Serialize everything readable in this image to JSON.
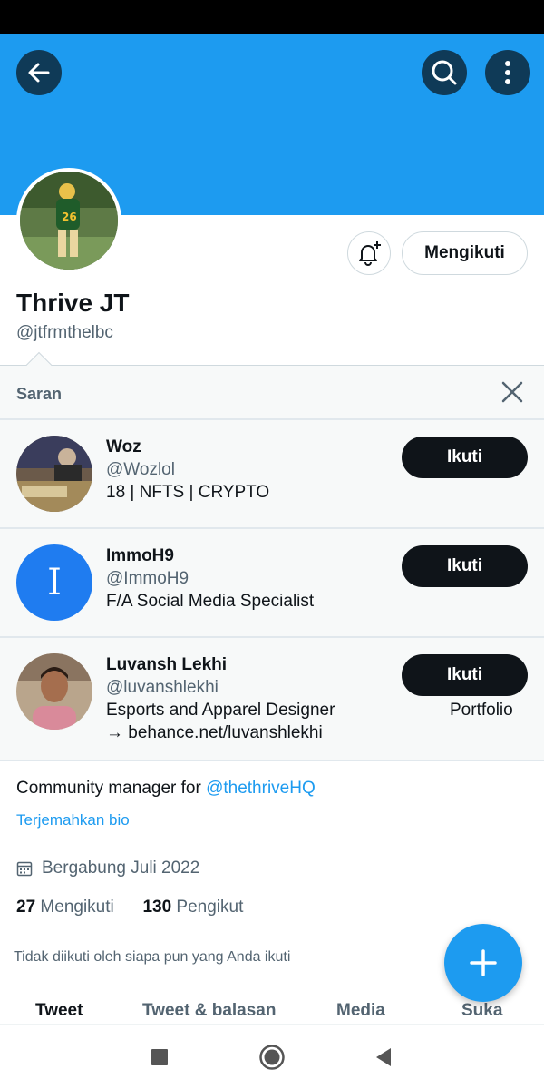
{
  "profile": {
    "name": "Thrive JT",
    "handle": "@jtfrmthelbc",
    "follow_status_label": "Mengikuti",
    "bio_text": "Community manager for ",
    "bio_link": "@thethriveHQ",
    "translate_label": "Terjemahkan bio",
    "joined": "Bergabung Juli 2022",
    "following_count": "27",
    "following_label": "Mengikuti",
    "followers_count": "130",
    "followers_label": "Pengikut",
    "followed_by_note": "Tidak diikuti oleh siapa pun yang Anda ikuti"
  },
  "suggestions": {
    "title": "Saran",
    "follow_label": "Ikuti",
    "items": [
      {
        "name": "Woz",
        "handle": "@Wozlol",
        "bio_line1": "18 | NFTS | CRYPTO",
        "bio_line2": "",
        "extra": ""
      },
      {
        "name": "ImmoH9",
        "handle": "@ImmoH9",
        "bio_line1": "F/A Social Media Specialist",
        "bio_line2": "",
        "extra": ""
      },
      {
        "name": "Luvansh Lekhi",
        "handle": "@luvanshlekhi",
        "bio_line1": "Esports and Apparel Designer",
        "bio_line2": "→ behance.net/luvanshlekhi",
        "extra": "Portfolio"
      }
    ]
  },
  "tabs": [
    "Tweet",
    "Tweet & balasan",
    "Media",
    "Suka"
  ],
  "immo_initial": "I",
  "icons": [
    "back-arrow-icon",
    "search-icon",
    "more-vertical-icon",
    "bell-plus-icon",
    "close-icon",
    "calendar-icon",
    "plus-icon",
    "square-nav-icon",
    "circle-home-icon",
    "triangle-back-icon"
  ],
  "colors": {
    "accent": "#1d9bf0",
    "text": "#0f1419",
    "muted": "#536471",
    "dark_button": "#0f1419"
  }
}
